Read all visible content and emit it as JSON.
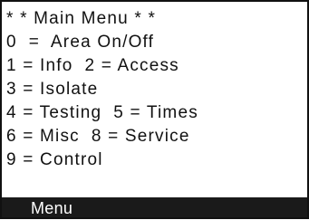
{
  "menu": {
    "title": "* * Main Menu * *",
    "options": [
      "0  =  Area On/Off",
      "1 = Info  2 = Access",
      "3 = Isolate",
      "4 = Testing  5 = Times",
      "6 = Misc  8 = Service",
      "9 = Control"
    ]
  },
  "softkey": {
    "label": "Menu"
  },
  "colors": {
    "text": "#111111",
    "background": "#ffffff",
    "softkey_bar": "#1a1a1a",
    "softkey_text": "#ffffff"
  }
}
